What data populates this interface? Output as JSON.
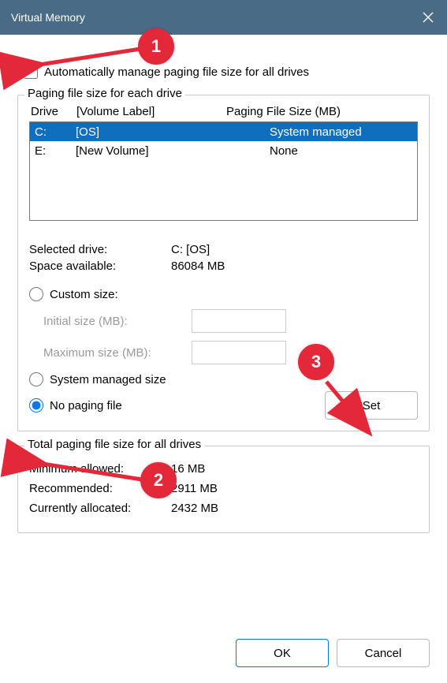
{
  "titlebar": {
    "title": "Virtual Memory"
  },
  "auto": {
    "label": "Automatically manage paging file size for all drives"
  },
  "group1": {
    "legend": "Paging file size for each drive",
    "headers": {
      "drive": "Drive",
      "vol": "[Volume Label]",
      "size": "Paging File Size (MB)"
    },
    "rows": [
      {
        "drive": "C:",
        "vol": "[OS]",
        "size": "System managed",
        "selected": true
      },
      {
        "drive": "E:",
        "vol": "[New Volume]",
        "size": "None",
        "selected": false
      }
    ],
    "selectedDriveLabel": "Selected drive:",
    "selectedDriveValue": "C:  [OS]",
    "spaceLabel": "Space available:",
    "spaceValue": "86084 MB",
    "customLabel": "Custom size:",
    "initialLabel": "Initial size (MB):",
    "maxLabel": "Maximum size (MB):",
    "systemManagedLabel": "System managed size",
    "noPagingLabel": "No paging file",
    "setLabel": "Set"
  },
  "group2": {
    "legend": "Total paging file size for all drives",
    "minLabel": "Minimum allowed:",
    "minValue": "16 MB",
    "recLabel": "Recommended:",
    "recValue": "2911 MB",
    "curLabel": "Currently allocated:",
    "curValue": "2432 MB"
  },
  "footer": {
    "okLabel": "OK",
    "cancelLabel": "Cancel"
  },
  "annotations": {
    "b1": "1",
    "b2": "2",
    "b3": "3"
  }
}
